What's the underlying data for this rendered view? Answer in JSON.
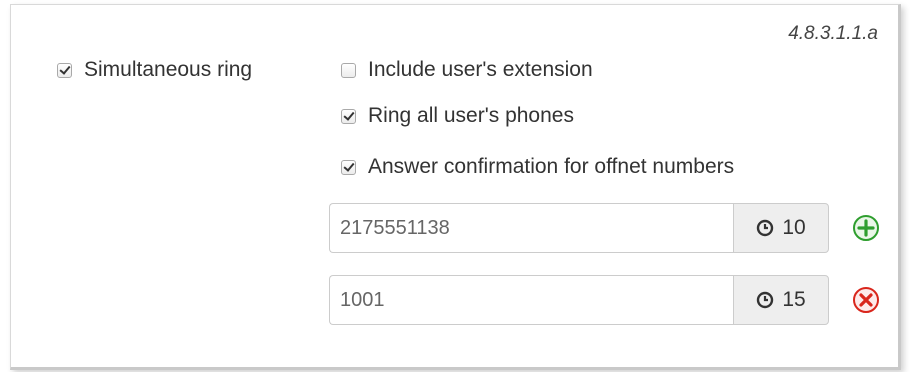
{
  "section_tag": "4.8.3.1.1.a",
  "simultaneous_ring": {
    "label": "Simultaneous ring",
    "checked": true
  },
  "options": [
    {
      "label": "Include user's extension",
      "checked": false
    },
    {
      "label": "Ring all user's phones",
      "checked": true
    },
    {
      "label": "Answer confirmation for offnet numbers",
      "checked": true
    }
  ],
  "numbers": [
    {
      "value": "2175551138",
      "timer": "10",
      "action": "add"
    },
    {
      "value": "1001",
      "timer": "15",
      "action": "remove"
    }
  ],
  "colors": {
    "add": "#2e9e2e",
    "remove": "#d9261c"
  }
}
